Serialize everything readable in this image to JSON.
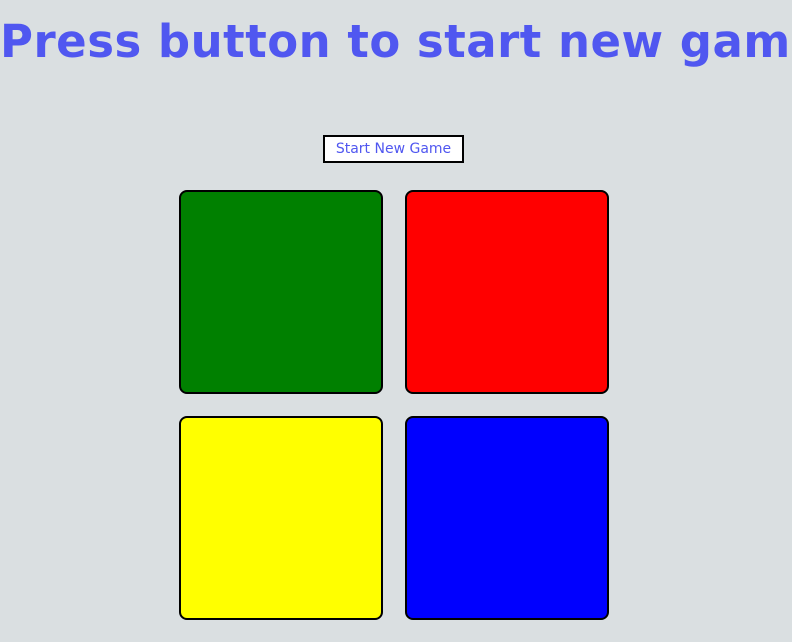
{
  "title": "Press button to start new game",
  "start_button_label": "Start New Game",
  "colors": {
    "background": "#dadfe1",
    "accent": "#5057f0",
    "pad_green": "#008000",
    "pad_red": "#ff0000",
    "pad_yellow": "#ffff00",
    "pad_blue": "#0000ff"
  }
}
